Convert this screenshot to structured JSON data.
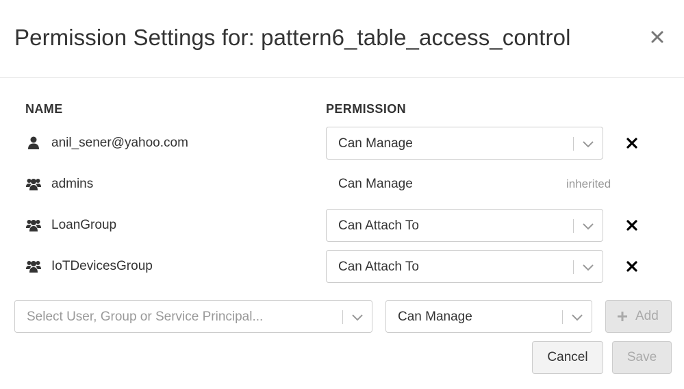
{
  "dialog": {
    "title": "Permission Settings for: pattern6_table_access_control",
    "close_icon": "close-icon"
  },
  "columns": {
    "name": "NAME",
    "permission": "PERMISSION"
  },
  "rows": [
    {
      "icon": "user-icon",
      "name": "anil_sener@yahoo.com",
      "permission": "Can Manage",
      "editable": true,
      "removable": true
    },
    {
      "icon": "group-icon",
      "name": "admins",
      "permission": "Can Manage",
      "editable": false,
      "note": "inherited"
    },
    {
      "icon": "group-icon",
      "name": "LoanGroup",
      "permission": "Can Attach To",
      "editable": true,
      "removable": true
    },
    {
      "icon": "group-icon",
      "name": "IoTDevicesGroup",
      "permission": "Can Attach To",
      "editable": true,
      "removable": true
    }
  ],
  "add_form": {
    "principal_placeholder": "Select User, Group or Service Principal...",
    "permission_value": "Can Manage",
    "add_label": "Add"
  },
  "footer": {
    "cancel_label": "Cancel",
    "save_label": "Save"
  },
  "colors": {
    "text": "#333333",
    "muted": "#999999",
    "border": "#cccccc",
    "disabled_bg": "#e6e6e6"
  }
}
